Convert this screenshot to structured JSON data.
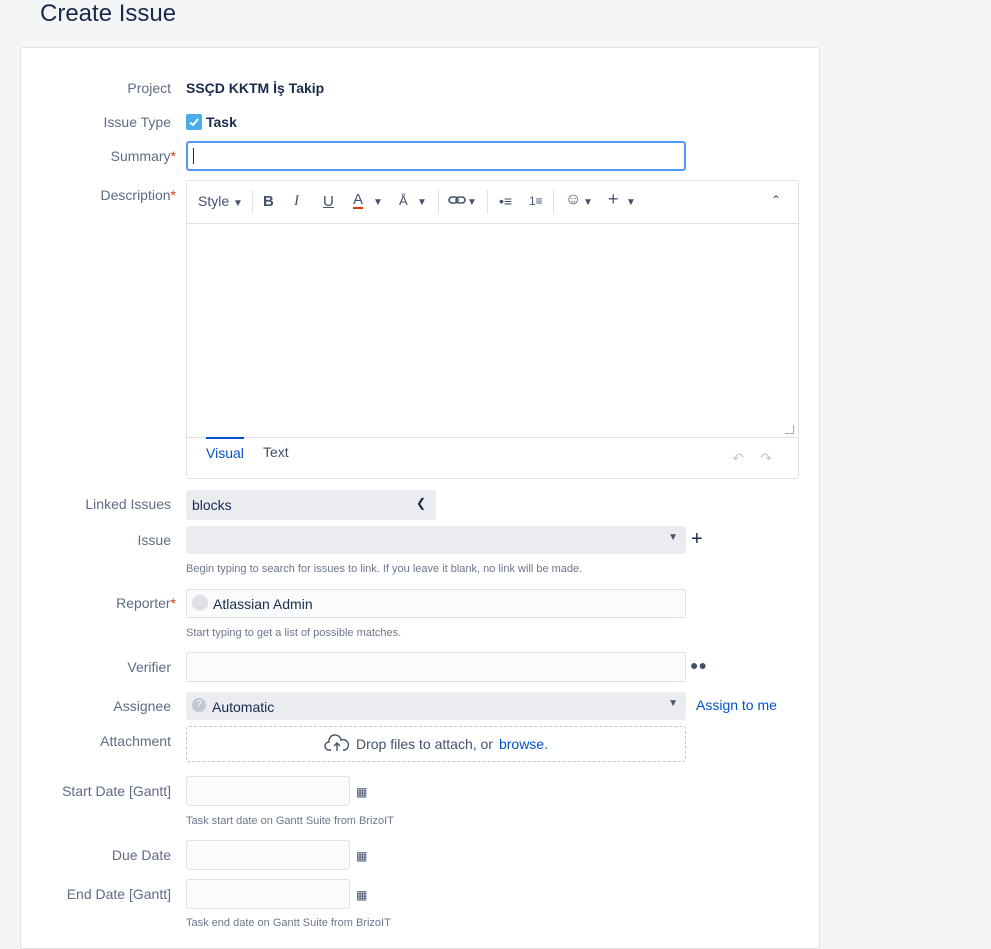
{
  "page_title": "Create Issue",
  "fields": {
    "project": {
      "label": "Project",
      "value": "SSÇD KKTM İş Takip"
    },
    "issue_type": {
      "label": "Issue Type",
      "value": "Task"
    },
    "summary": {
      "label": "Summary",
      "required_mark": "*",
      "value": ""
    },
    "description": {
      "label": "Description",
      "required_mark": "*"
    },
    "linked_issues": {
      "label": "Linked Issues",
      "value": "blocks"
    },
    "issue": {
      "label": "Issue",
      "value": "",
      "help": "Begin typing to search for issues to link. If you leave it blank, no link will be made."
    },
    "reporter": {
      "label": "Reporter",
      "required_mark": "*",
      "value": "Atlassian Admin",
      "help": "Start typing to get a list of possible matches."
    },
    "verifier": {
      "label": "Verifier",
      "value": ""
    },
    "assignee": {
      "label": "Assignee",
      "value": "Automatic",
      "assign_to_me": "Assign to me"
    },
    "attachment": {
      "label": "Attachment",
      "drop_text": "Drop files to attach, or",
      "browse": "browse."
    },
    "start_date": {
      "label": "Start Date [Gantt]",
      "value": "",
      "help": "Task start date on Gantt Suite from BrizoIT"
    },
    "due_date": {
      "label": "Due Date",
      "value": ""
    },
    "end_date": {
      "label": "End Date [Gantt]",
      "value": "",
      "help": "Task end date on Gantt Suite from BrizoIT"
    }
  },
  "editor": {
    "style_label": "Style",
    "tabs": [
      "Visual",
      "Text"
    ],
    "active_tab": "Visual",
    "toolbar_icons": [
      "bold-icon",
      "italic-icon",
      "underline-icon",
      "text-color-icon",
      "text-format-icon",
      "link-icon",
      "bullet-list-icon",
      "numbered-list-icon",
      "emoji-icon",
      "insert-icon",
      "collapse-icon"
    ]
  },
  "colors": {
    "accent": "#0052cc",
    "focus": "#4c9aff",
    "required": "#de350b",
    "text_color_bar": "#de350b"
  }
}
